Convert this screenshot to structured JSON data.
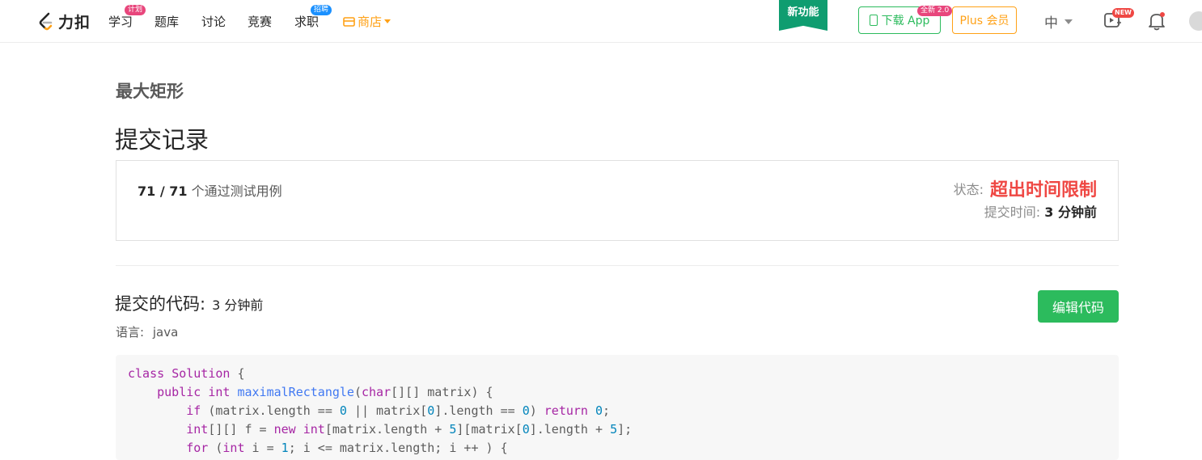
{
  "navbar": {
    "logo_text": "力扣",
    "items": [
      {
        "label": "学习",
        "badge": "计划",
        "badge_color": "#e8467c"
      },
      {
        "label": "题库"
      },
      {
        "label": "讨论"
      },
      {
        "label": "竞赛"
      },
      {
        "label": "求职",
        "badge": "招聘",
        "badge_color": "#1a90ff"
      }
    ],
    "shop_label": "商店",
    "feature_flag": "新功能",
    "download_app": "下载 App",
    "download_badge": "全新 2.0",
    "plus": "Plus 会员",
    "language": "中",
    "video_badge": "NEW"
  },
  "problem": {
    "title": "最大矩形"
  },
  "submission": {
    "page_title": "提交记录",
    "passed": "71 / 71",
    "passed_suffix": "个通过测试用例",
    "status_label": "状态:",
    "status_value": "超出时间限制",
    "time_label": "提交时间:",
    "time_value": "3 分钟前",
    "code_heading": "提交的代码:",
    "code_time": "3 分钟前",
    "language_label": "语言:",
    "language_value": "java",
    "edit_button": "编辑代码"
  },
  "code_lines": [
    "class Solution {",
    "    public int maximalRectangle(char[][] matrix) {",
    "        if (matrix.length == 0 || matrix[0].length == 0) return 0;",
    "        int[][] f = new int[matrix.length + 5][matrix[0].length + 5];",
    "        for (int i = 1; i <= matrix.length; i ++ ) {"
  ],
  "colors": {
    "accent_green": "#2cbb5d",
    "status_red": "#ef4743",
    "shop_orange": "#ffa116",
    "feature_teal": "#0f9d70"
  }
}
